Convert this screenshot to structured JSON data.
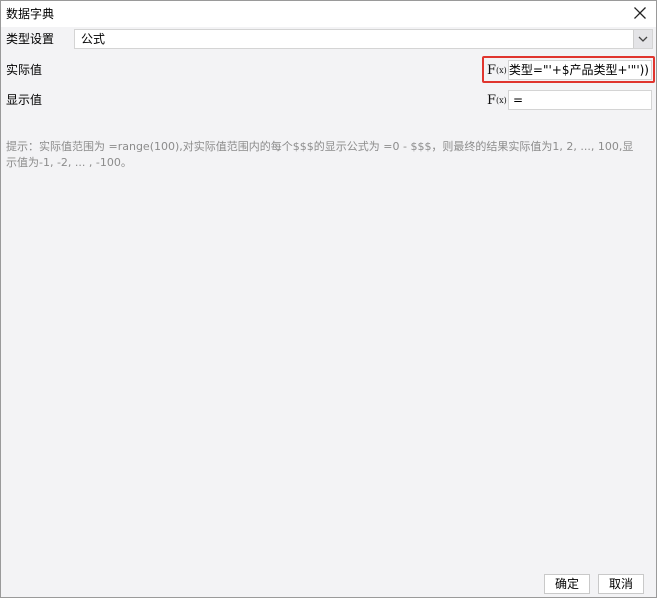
{
  "window": {
    "title": "数据字典"
  },
  "type_setting": {
    "label": "类型设置",
    "selected": "公式"
  },
  "actual_value": {
    "label": "实际值",
    "fx_label": "F(x)",
    "formula": "品类型=\"'+$产品类型+'\"'))"
  },
  "display_value": {
    "label": "显示值",
    "fx_label": "F(x)",
    "formula": "="
  },
  "hint": "提示：实际值范围为 =range(100),对实际值范围内的每个$$$的显示公式为 =0 - $$$，则最终的结果实际值为1, 2, ..., 100,显示值为-1, -2, ... , -100。",
  "buttons": {
    "ok": "确定",
    "cancel": "取消"
  },
  "colors": {
    "highlight": "#e0352e",
    "hint_text": "#8c8c8c",
    "dialog_bg": "#f3f3f5"
  }
}
